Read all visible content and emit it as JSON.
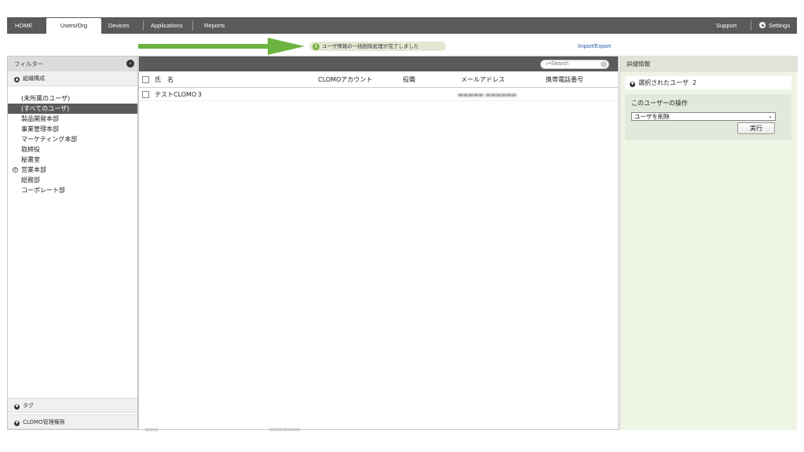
{
  "nav": {
    "home": "HOME",
    "users_org": "Users/Org",
    "devices": "Devices",
    "applications": "Applications",
    "reports": "Reports",
    "support": "Support",
    "settings": "Settings"
  },
  "notice": {
    "text": "ユーザ情報の一括削除処理が完了しました",
    "icon": "!"
  },
  "import_export": "Import/Export",
  "filter": {
    "title": "フィルター",
    "org_section": "組織構成",
    "org_items": [
      "(未所属のユーザ)",
      "(すべてのユーザ)",
      "製品開発本部",
      "事業管理本部",
      "マーケティング本部",
      "取締役",
      "秘書室",
      "営業本部",
      "総務部",
      "コーポレート部"
    ],
    "tag_section": "タグ",
    "clomo_section": "CLOMO管理権限"
  },
  "table": {
    "search_placeholder": "Search",
    "headers": {
      "name": "氏　名",
      "account": "CLOMOアカウント",
      "role": "役職",
      "email": "メールアドレス",
      "phone": "携帯電話番号"
    },
    "rows": [
      {
        "name": "テストCLOMO３",
        "account": "",
        "role": "",
        "email": "",
        "phone": ""
      }
    ]
  },
  "details": {
    "title": "詳細情報",
    "selected_label": "選択されたユーザ",
    "selected_count": "2",
    "operation_title": "このユーザーの操作",
    "operation_selected": "ユーザを削除",
    "exec_label": "実行"
  },
  "colors": {
    "nav_bg": "#5a5a5a",
    "accent_green": "#6db33f",
    "link": "#2a5fa8",
    "detail_bg": "#eef5e4"
  }
}
